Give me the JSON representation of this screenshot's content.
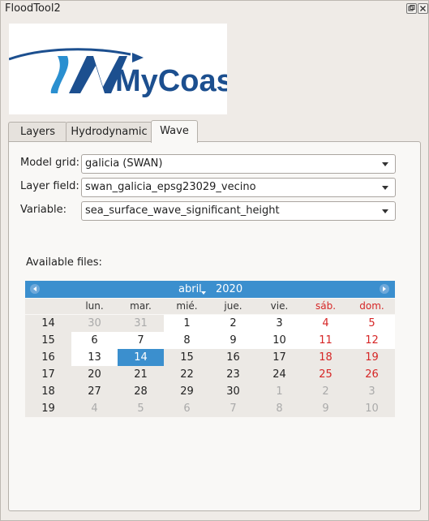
{
  "window": {
    "title": "FloodTool2",
    "float_icon": "float-icon",
    "close_icon": "close-icon"
  },
  "logo": {
    "text": "MyCoast",
    "colors": {
      "blue": "#1c4f8f",
      "light_blue": "#2a8fd0"
    }
  },
  "tabs": [
    {
      "label": "Layers",
      "active": false
    },
    {
      "label": "Hydrodynamic",
      "active": false
    },
    {
      "label": "Wave",
      "active": true
    }
  ],
  "form": {
    "model_grid": {
      "label": "Model grid:",
      "value": "galicia (SWAN)"
    },
    "layer_field": {
      "label": "Layer field:",
      "value": "swan_galicia_epsg23029_vecino"
    },
    "variable": {
      "label": "Variable:",
      "value": "sea_surface_wave_significant_height"
    }
  },
  "available_files_label": "Available files:",
  "calendar": {
    "month": "abril",
    "year": "2020",
    "prev_icon": "arrow-left-icon",
    "next_icon": "arrow-right-icon",
    "weekdays": [
      "lun.",
      "mar.",
      "mié.",
      "jue.",
      "vie.",
      "sáb.",
      "dom."
    ],
    "weeks": [
      "14",
      "15",
      "16",
      "17",
      "18",
      "19"
    ],
    "days": [
      [
        "30",
        "31",
        "1",
        "2",
        "3",
        "4",
        "5"
      ],
      [
        "6",
        "7",
        "8",
        "9",
        "10",
        "11",
        "12"
      ],
      [
        "13",
        "14",
        "15",
        "16",
        "17",
        "18",
        "19"
      ],
      [
        "20",
        "21",
        "22",
        "23",
        "24",
        "25",
        "26"
      ],
      [
        "27",
        "28",
        "29",
        "30",
        "1",
        "2",
        "3"
      ],
      [
        "4",
        "5",
        "6",
        "7",
        "8",
        "9",
        "10"
      ]
    ],
    "selected": "14",
    "colors": {
      "header": "#3b8fce",
      "weekend": "#d62626",
      "selected": "#3b8fce"
    }
  }
}
